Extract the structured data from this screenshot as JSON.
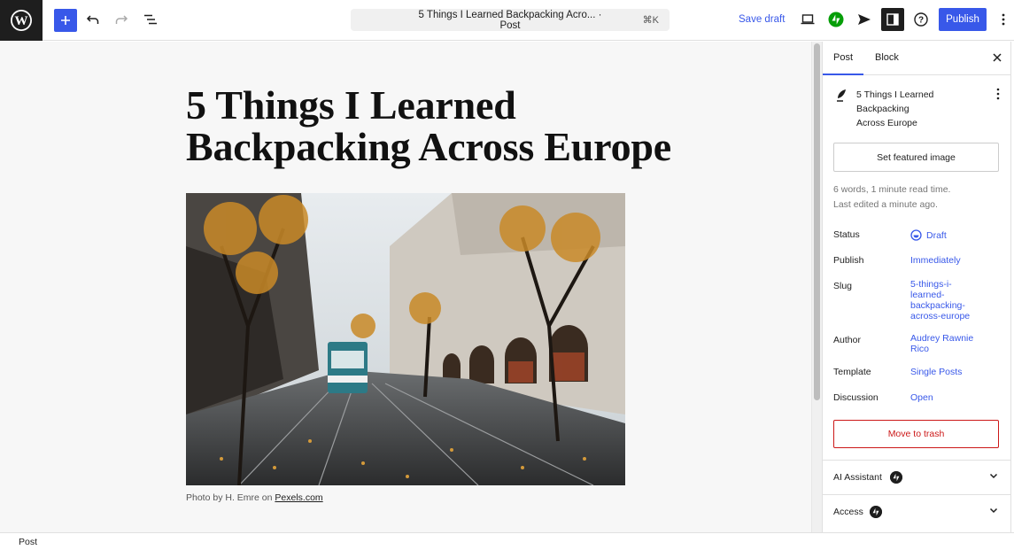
{
  "toolbar": {
    "logo": "wordpress-logo",
    "add_block_icon": "plus-icon",
    "undo_icon": "undo-icon",
    "redo_icon": "redo-icon",
    "list_view_icon": "list-view-icon",
    "document_title": "5 Things I Learned Backpacking Acro... · Post",
    "shortcut": "⌘K",
    "save_draft_label": "Save draft",
    "publish_label": "Publish",
    "accent_color": "#3858e9",
    "jetpack_color": "#069e08"
  },
  "canvas": {
    "post_title": "5 Things I Learned Backpacking Across Europe",
    "caption_prefix": "Photo by H. Emre on ",
    "caption_link": "Pexels.com"
  },
  "sidebar": {
    "tabs": [
      {
        "label": "Post",
        "active": true
      },
      {
        "label": "Block",
        "active": false
      }
    ],
    "document_title": "5 Things I Learned Backpacking Across Europe",
    "document_title_lines": [
      "5 Things I Learned",
      "Backpacking",
      "Across Europe"
    ],
    "featured_image_label": "Set featured image",
    "word_count": "6 words, 1 minute read time.",
    "last_edited": "Last edited a minute ago.",
    "rows": [
      {
        "label": "Status",
        "value": "Draft"
      },
      {
        "label": "Publish",
        "value": "Immediately"
      },
      {
        "label": "Slug",
        "value": "5-things-i-learned-backpacking-across-europe",
        "value_lines": [
          "5-things-i-",
          "learned-",
          "backpacking-",
          "across-europe"
        ]
      },
      {
        "label": "Author",
        "value": "Audrey Rawnie Rico",
        "value_lines": [
          "Audrey Rawnie",
          "Rico"
        ]
      },
      {
        "label": "Template",
        "value": "Single Posts"
      },
      {
        "label": "Discussion",
        "value": "Open"
      }
    ],
    "trash_label": "Move to trash",
    "panels": [
      {
        "label": "AI Assistant",
        "expanded": false
      },
      {
        "label": "Access",
        "expanded": false
      }
    ]
  },
  "footer": {
    "breadcrumb": "Post"
  }
}
